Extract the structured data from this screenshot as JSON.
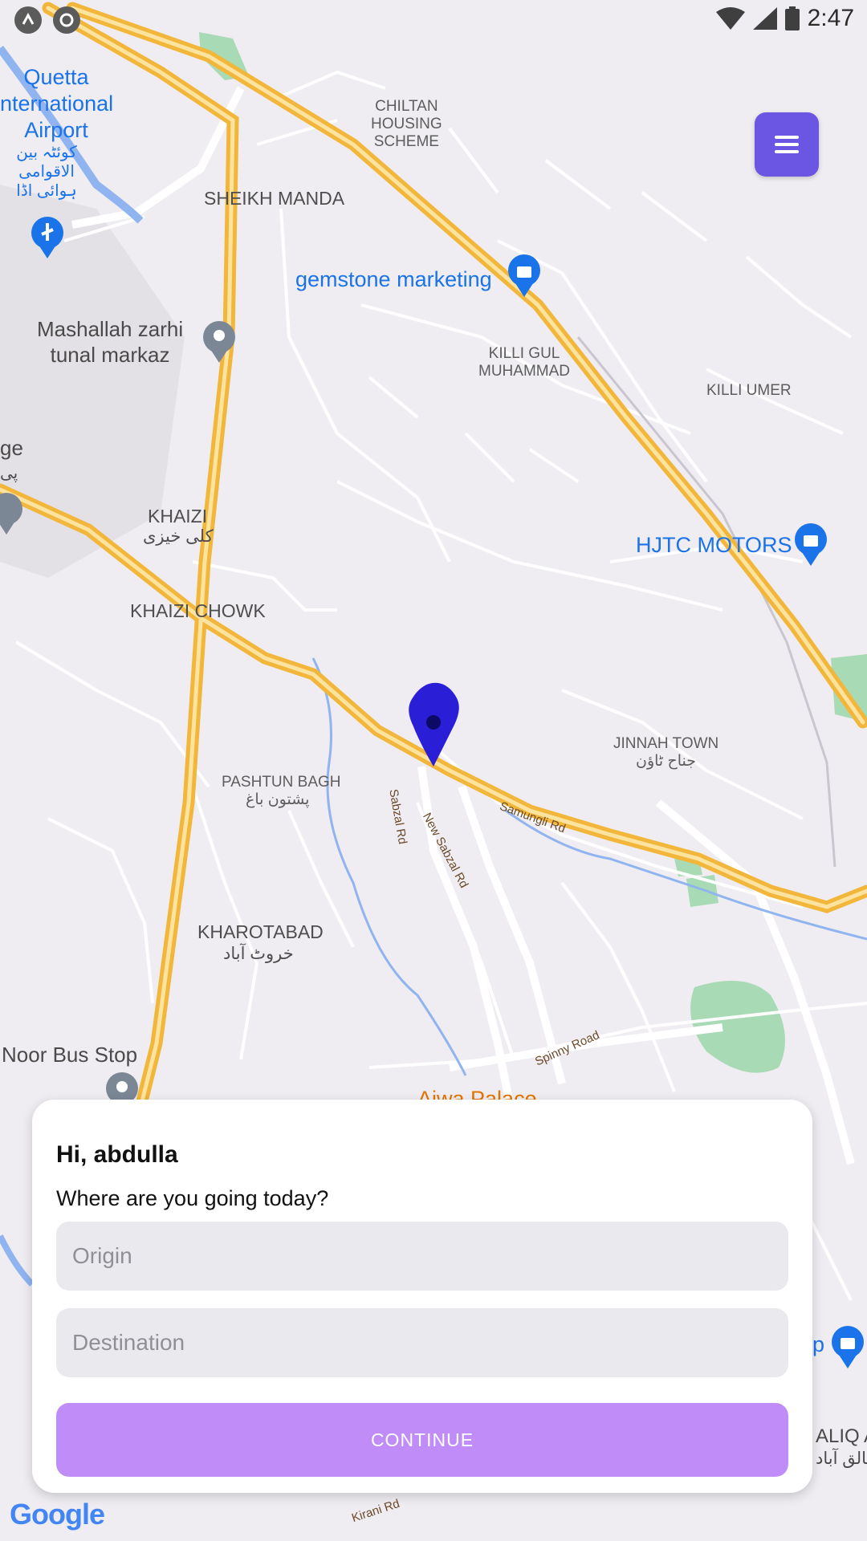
{
  "status_bar": {
    "time": "2:47"
  },
  "map": {
    "labels": {
      "airport_en": "Quetta\nnternational\nAirport",
      "airport_ur": "کوئٹہ بین\nالاقوامی\nہوائی اڈا",
      "chiltan": "CHILTAN\nHOUSING\nSCHEME",
      "sheikh_manda": "SHEIKH MANDA",
      "gemstone": "gemstone marketing",
      "mashallah": "Mashallah zarhi\ntunal markaz",
      "killi_gul": "KILLI GUL\nMUHAMMAD",
      "killi_umer": "KILLI UMER",
      "ge": "ge",
      "ge_ur": "پی",
      "khaizi": "KHAIZI",
      "khaizi_ur": "کلی خیزی",
      "hjtc": "HJTC MOTORS",
      "khaizi_chowk": "KHAIZI CHOWK",
      "jinnah_town": "JINNAH TOWN",
      "jinnah_town_ur": "جناح ٹاؤن",
      "pashtun_bagh": "PASHTUN BAGH",
      "pashtun_bagh_ur": "پشتون باغ",
      "samungli_rd": "Samungli Rd",
      "sabzal_rd": "Sabzal Rd",
      "new_sabzal_rd": "New Sabzal Rd",
      "kharotabad": "KHAROTABAD",
      "kharotabad_ur": "خروٹ آباد",
      "noor_bus": "Noor Bus Stop",
      "spinny_road": "Spinny Road",
      "aiwa_palace": "Aiwa Palace",
      "p_partial": "p",
      "aliq": "ALIQ AI",
      "aliq_ur": "خالق آباد",
      "kirani_rd": "Kirani Rd"
    },
    "google_logo": "Google",
    "accent_marker": "#2a1fd6"
  },
  "menu_button": {
    "icon": "hamburger-icon",
    "color": "#6b55e3"
  },
  "card": {
    "greeting": "Hi, abdulla",
    "question": "Where are you going today?",
    "origin_placeholder": "Origin",
    "destination_placeholder": "Destination",
    "continue_label": "CONTINUE",
    "continue_color": "#c08cf8"
  }
}
